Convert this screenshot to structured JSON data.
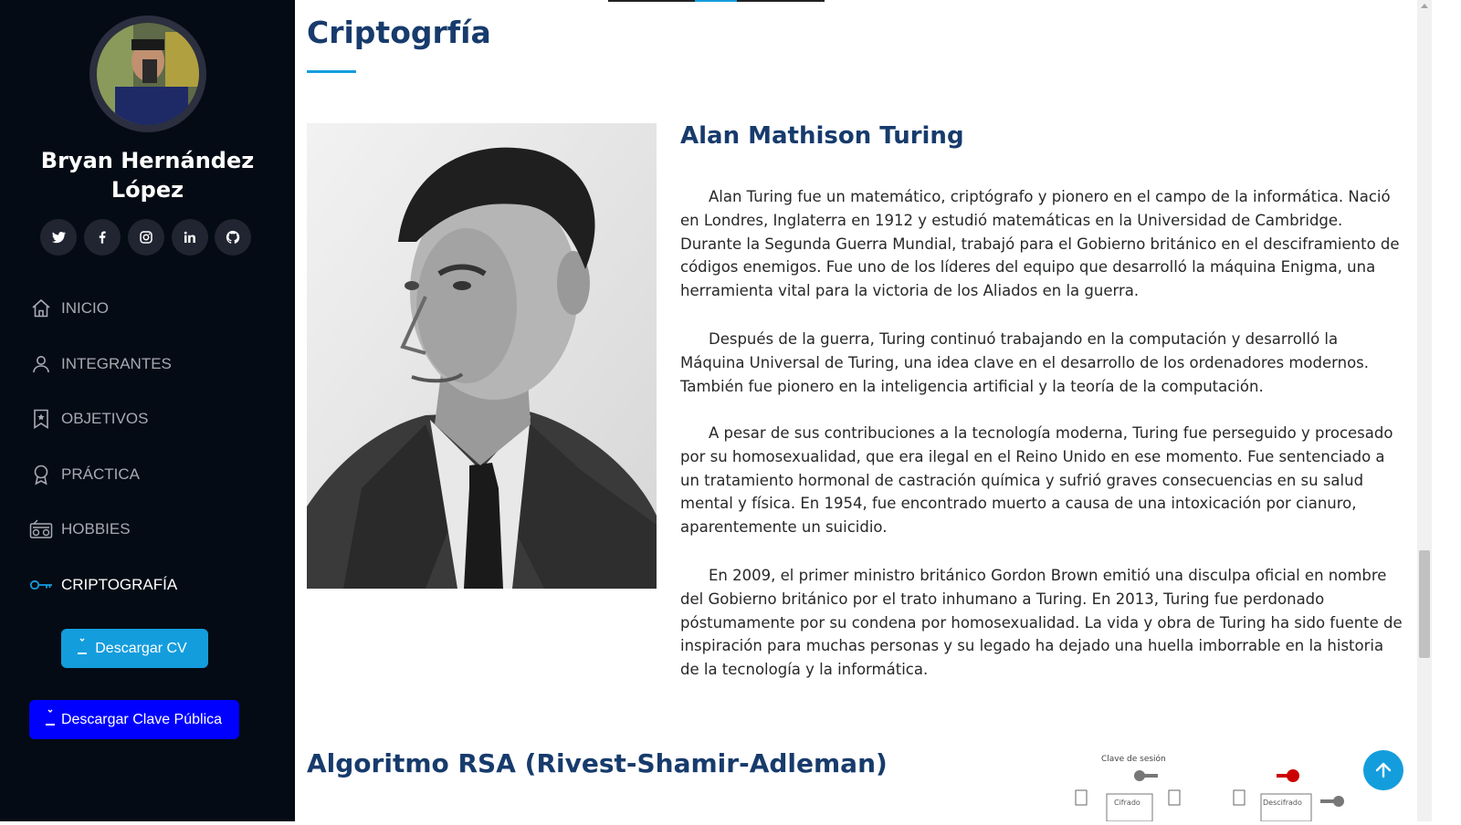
{
  "sidebar": {
    "profile_name": "Bryan Hernández López",
    "social": [
      "twitter-icon",
      "facebook-icon",
      "instagram-icon",
      "linkedin-icon",
      "github-icon"
    ],
    "nav": [
      {
        "label": "INICIO",
        "icon": "home-icon",
        "active": false
      },
      {
        "label": "INTEGRANTES",
        "icon": "user-icon",
        "active": false
      },
      {
        "label": "OBJETIVOS",
        "icon": "bookmark-star-icon",
        "active": false
      },
      {
        "label": "PRÁCTICA",
        "icon": "award-icon",
        "active": false
      },
      {
        "label": "HOBBIES",
        "icon": "radio-icon",
        "active": false
      },
      {
        "label": "CRIPTOGRAFÍA",
        "icon": "key-icon",
        "active": true
      }
    ],
    "download_cv_label": "Descargar CV",
    "download_key_label": "Descargar Clave Pública"
  },
  "main": {
    "section_title": "Criptogrfía",
    "bio": {
      "heading": "Alan Mathison Turing",
      "paragraphs": [
        "Alan Turing fue un matemático, criptógrafo y pionero en el campo de la informática. Nació en Londres, Inglaterra en 1912 y estudió matemáticas en la Universidad de Cambridge. Durante la Segunda Guerra Mundial, trabajó para el Gobierno británico en el desciframiento de códigos enemigos. Fue uno de los líderes del equipo que desarrolló la máquina Enigma, una herramienta vital para la victoria de los Aliados en la guerra.",
        "Después de la guerra, Turing continuó trabajando en la computación y desarrolló la Máquina Universal de Turing, una idea clave en el desarrollo de los ordenadores modernos. También fue pionero en la inteligencia artificial y la teoría de la computación.",
        "A pesar de sus contribuciones a la tecnología moderna, Turing fue perseguido y procesado por su homosexualidad, que era ilegal en el Reino Unido en ese momento. Fue sentenciado a un tratamiento hormonal de castración química y sufrió graves consecuencias en su salud mental y física. En 1954, fue encontrado muerto a causa de una intoxicación por cianuro, aparentemente un suicidio.",
        "En 2009, el primer ministro británico Gordon Brown emitió una disculpa oficial en nombre del Gobierno británico por el trato inhumano a Turing. En 2013, Turing fue perdonado póstumamente por su condena por homosexualidad. La vida y obra de Turing ha sido fuente de inspiración para muchas personas y su legado ha dejado una huella imborrable en la historia de la tecnología y la informática."
      ]
    },
    "rsa": {
      "heading": "Algoritmo RSA (Rivest-Shamir-Adleman)",
      "diagram_labels": {
        "session_key": "Clave de sesión",
        "encrypt": "Cifrado",
        "decrypt": "Descifrado"
      }
    },
    "back_to_top_icon": "arrow-up-icon"
  },
  "colors": {
    "sidebar_bg": "#040b14",
    "accent": "#149ddd",
    "heading": "#173b6c",
    "key_button": "#0000ff"
  }
}
